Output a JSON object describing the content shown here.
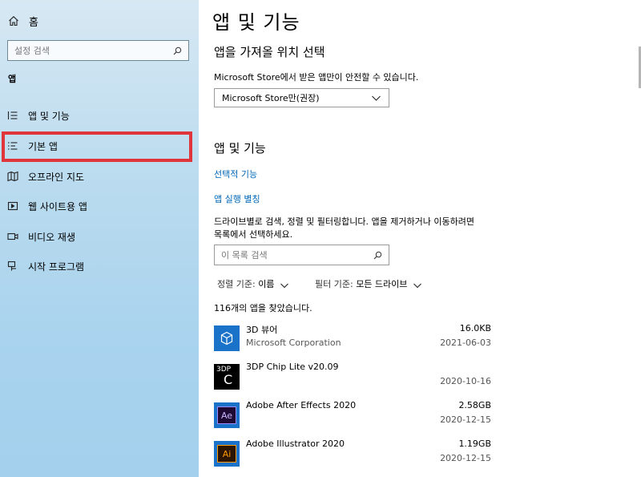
{
  "sidebar": {
    "home_label": "홈",
    "search_placeholder": "설정 검색",
    "section_title": "앱",
    "items": [
      {
        "label": "앱 및 기능",
        "icon": "apps-features-icon"
      },
      {
        "label": "기본 앱",
        "icon": "default-apps-icon"
      },
      {
        "label": "오프라인 지도",
        "icon": "offline-maps-icon"
      },
      {
        "label": "웹 사이트용 앱",
        "icon": "apps-for-websites-icon"
      },
      {
        "label": "비디오 재생",
        "icon": "video-playback-icon"
      },
      {
        "label": "시작 프로그램",
        "icon": "startup-icon"
      }
    ],
    "selected_item": "기본 앱",
    "highlight_color": "#e0353b"
  },
  "main": {
    "page_title": "앱 및 기능",
    "install_section": {
      "title": "앱을 가져올 위치 선택",
      "description": "Microsoft Store에서 받은 앱만이 안전할 수 있습니다.",
      "dropdown_value": "Microsoft Store만(권장)"
    },
    "features_section": {
      "title": "앱 및 기능",
      "optional_features_link": "선택적 기능",
      "app_aliases_link": "앱 실행 별칭",
      "description_line1": "드라이브별로 검색, 정렬 및 필터링합니다. 앱을 제거하거나 이동하려면",
      "description_line2": "목록에서 선택하세요.",
      "search_placeholder": "이 목록 검색",
      "sort_label": "정렬 기준:",
      "sort_value": "이름",
      "filter_label": "필터 기준:",
      "filter_value": "모든 드라이브",
      "count_text": "116개의 앱을 찾았습니다."
    },
    "apps": [
      {
        "name": "3D 뷰어",
        "publisher": "Microsoft Corporation",
        "size": "16.0KB",
        "date": "2021-06-03",
        "icon": "3d-viewer-icon"
      },
      {
        "name": "3DP Chip Lite v20.09",
        "publisher": "",
        "size": "",
        "date": "2020-10-16",
        "icon": "3dp-chip-icon"
      },
      {
        "name": "Adobe After Effects 2020",
        "publisher": "",
        "size": "2.58GB",
        "date": "2020-12-15",
        "icon": "after-effects-icon"
      },
      {
        "name": "Adobe Illustrator 2020",
        "publisher": "",
        "size": "1.19GB",
        "date": "2020-12-15",
        "icon": "illustrator-icon"
      }
    ],
    "link_color": "#0067b8"
  }
}
